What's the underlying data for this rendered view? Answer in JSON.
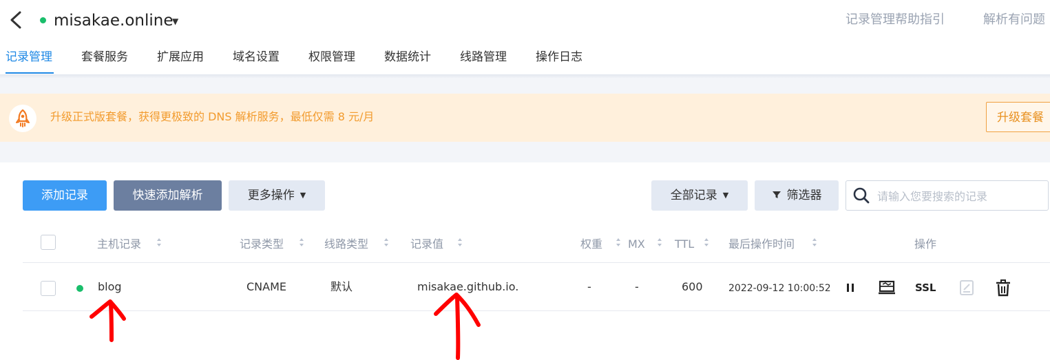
{
  "header": {
    "domain": "misakae.online",
    "help_links": [
      "记录管理帮助指引",
      "解析有问题"
    ]
  },
  "tabs": [
    {
      "label": "记录管理",
      "active": true
    },
    {
      "label": "套餐服务"
    },
    {
      "label": "扩展应用"
    },
    {
      "label": "域名设置"
    },
    {
      "label": "权限管理"
    },
    {
      "label": "数据统计"
    },
    {
      "label": "线路管理"
    },
    {
      "label": "操作日志"
    }
  ],
  "banner": {
    "text": "升级正式版套餐，获得更极致的 DNS 解析服务，最低仅需 8 元/月",
    "button": "升级套餐"
  },
  "toolbar": {
    "add_record": "添加记录",
    "quick_add": "快速添加解析",
    "more_ops": "更多操作",
    "all_records": "全部记录",
    "filter": "筛选器"
  },
  "search": {
    "placeholder": "请输入您要搜索的记录"
  },
  "table": {
    "columns": [
      "主机记录",
      "记录类型",
      "线路类型",
      "记录值",
      "权重",
      "MX",
      "TTL",
      "最后操作时间",
      "操作"
    ],
    "rows": [
      {
        "host": "blog",
        "type": "CNAME",
        "line": "默认",
        "value": "misakae.github.io.",
        "weight": "-",
        "mx": "-",
        "ttl": "600",
        "updated": "2022-09-12 10:00:52",
        "actions": [
          "pause",
          "monitor",
          "SSL",
          "edit",
          "delete"
        ]
      }
    ]
  },
  "icons": {
    "back": "chevron-left-icon",
    "banner": "rocket-icon",
    "search": "search-icon",
    "filter": "funnel-icon"
  },
  "colors": {
    "accent": "#1e88e5",
    "primary_button": "#3d9cf5",
    "secondary_button": "#6c7fa0",
    "banner_bg": "#fff0dc",
    "banner_text": "#f29b2e",
    "status_green": "#19be6b",
    "annotation_arrow": "#ff0000"
  }
}
